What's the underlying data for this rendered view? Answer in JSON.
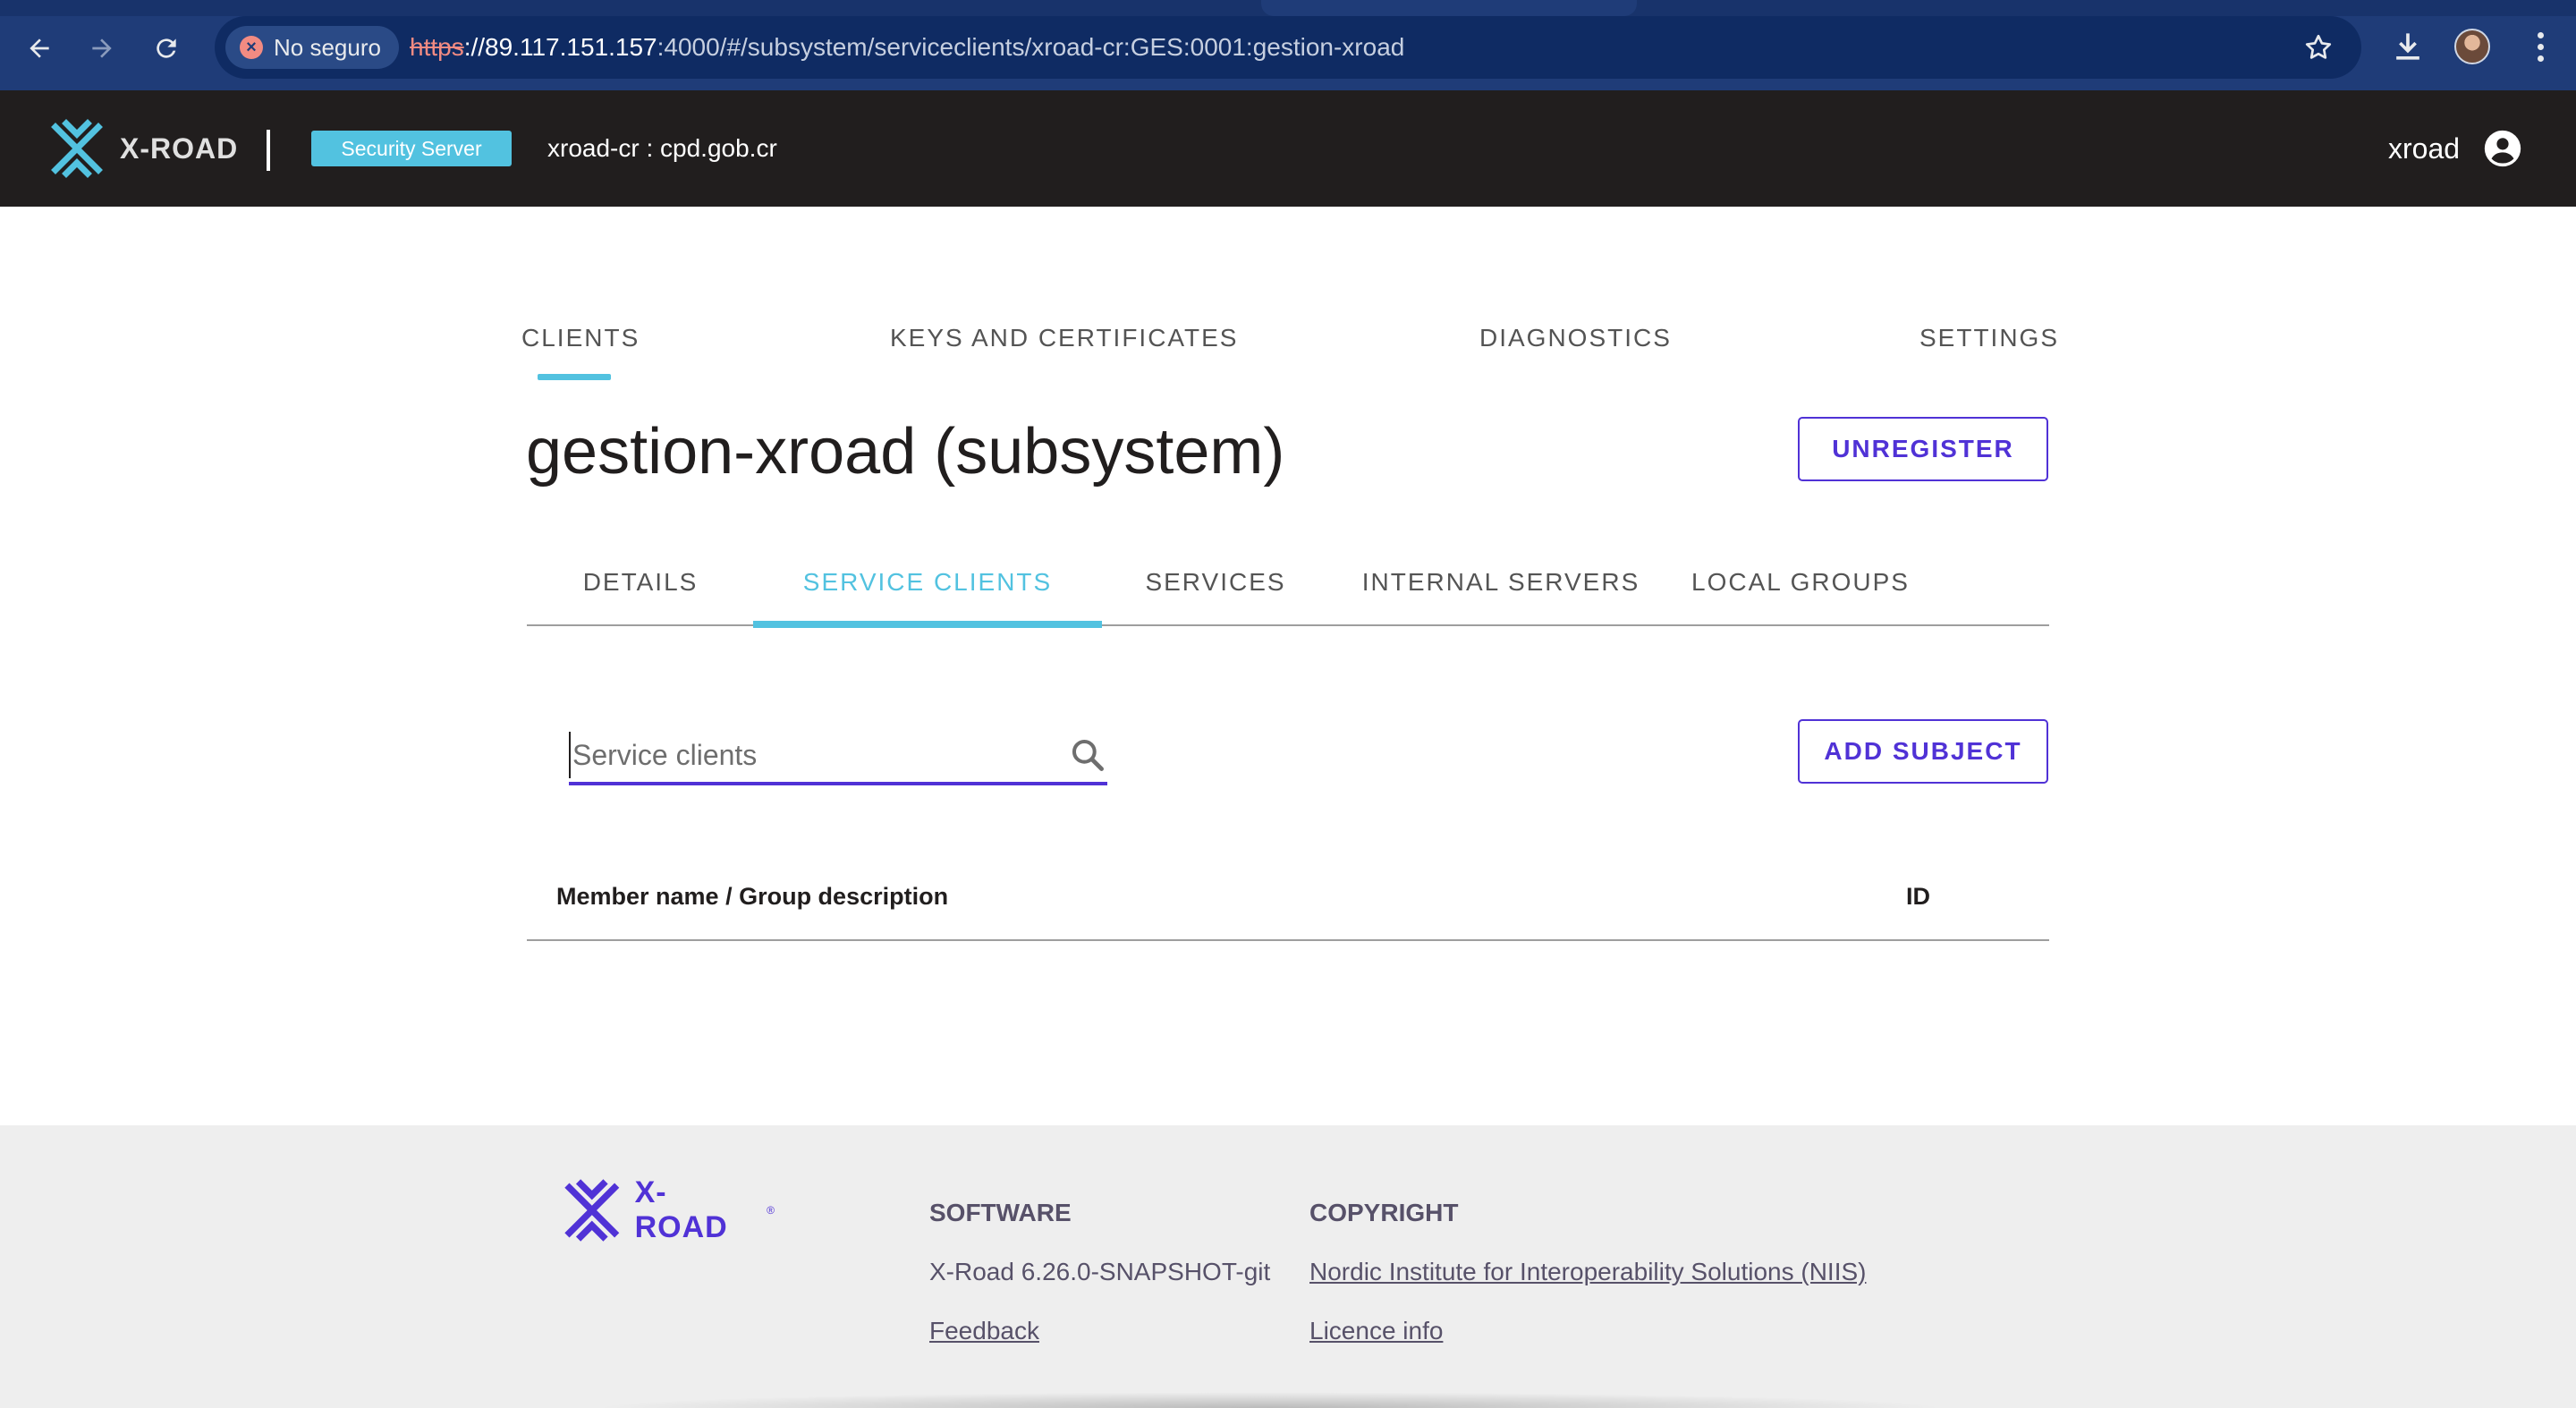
{
  "browser": {
    "security_label": "No seguro",
    "url_protocol": "https",
    "url_host": "://89.117.151.157",
    "url_rest": ":4000/#/subsystem/serviceclients/xroad-cr:GES:0001:gestion-xroad"
  },
  "header": {
    "logo_text": "X-ROAD",
    "server_chip": "Security Server",
    "server_id": "xroad-cr : cpd.gob.cr",
    "user_name": "xroad"
  },
  "main_nav": {
    "items": [
      {
        "label": "CLIENTS",
        "active": true
      },
      {
        "label": "KEYS AND CERTIFICATES",
        "active": false
      },
      {
        "label": "DIAGNOSTICS",
        "active": false
      },
      {
        "label": "SETTINGS",
        "active": false
      }
    ]
  },
  "page": {
    "title": "gestion-xroad (subsystem)",
    "unregister_label": "UNREGISTER"
  },
  "sub_tabs": {
    "items": [
      {
        "label": "DETAILS",
        "active": false
      },
      {
        "label": "SERVICE CLIENTS",
        "active": true
      },
      {
        "label": "SERVICES",
        "active": false
      },
      {
        "label": "INTERNAL SERVERS",
        "active": false
      },
      {
        "label": "LOCAL GROUPS",
        "active": false
      }
    ]
  },
  "service_clients": {
    "search_placeholder": "Service clients",
    "search_value": "",
    "add_subject_label": "ADD SUBJECT",
    "columns": [
      "Member name / Group description",
      "ID"
    ],
    "rows": []
  },
  "footer": {
    "logo_text": "X-ROAD",
    "software_heading": "SOFTWARE",
    "version": "X-Road 6.26.0-SNAPSHOT-git",
    "feedback_link": "Feedback",
    "copyright_heading": "COPYRIGHT",
    "niis_link": "Nordic Institute for Interoperability Solutions (NIIS)",
    "licence_link": "Licence info"
  },
  "colors": {
    "browser_chrome": "#1f3c78",
    "app_header": "#211e1e",
    "accent_teal": "#52c2e0",
    "primary_purple": "#5032d6",
    "footer_bg": "#eeeeee"
  }
}
